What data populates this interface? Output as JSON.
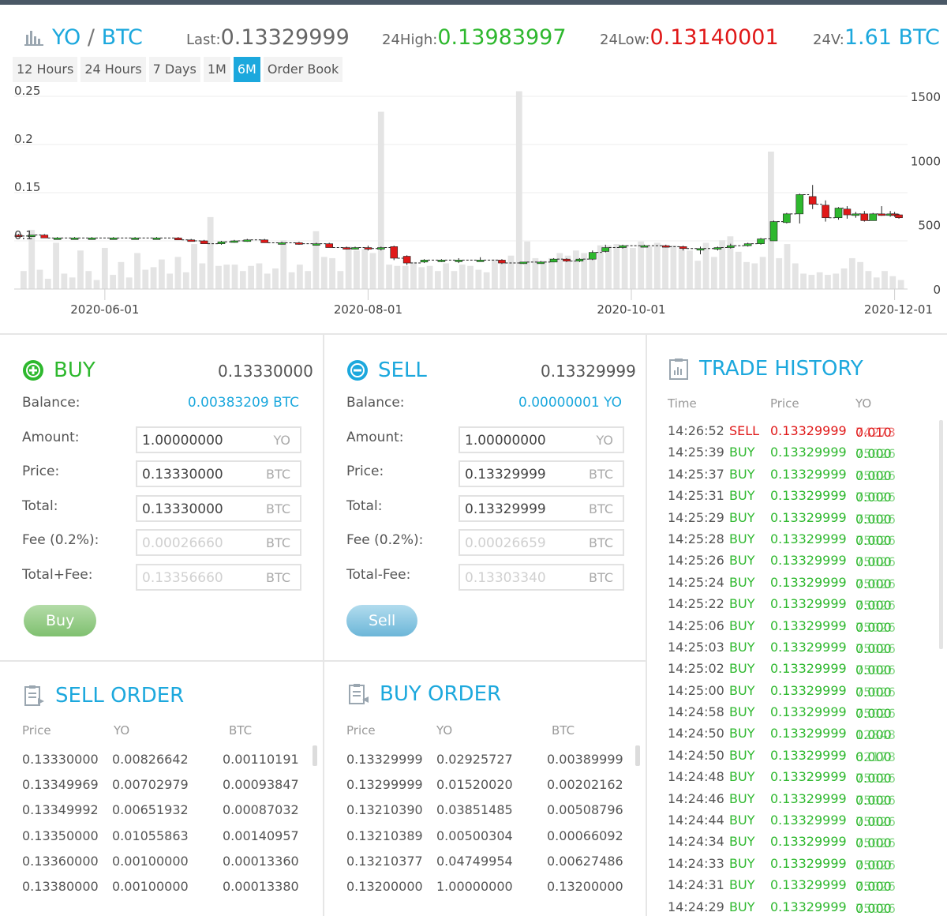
{
  "header": {
    "pair_base": "YO",
    "pair_sep": "/",
    "pair_quote": "BTC",
    "last_label": "Last:",
    "last_value": "0.13329999",
    "high_label": "24High:",
    "high_value": "0.13983997",
    "low_label": "24Low:",
    "low_value": "0.13140001",
    "vol_label": "24V:",
    "vol_value": "1.61 BTC"
  },
  "range_tabs": [
    {
      "label": "12 Hours",
      "active": false
    },
    {
      "label": "24 Hours",
      "active": false
    },
    {
      "label": "7 Days",
      "active": false
    },
    {
      "label": "1M",
      "active": false
    },
    {
      "label": "6M",
      "active": true
    },
    {
      "label": "Order Book",
      "active": false
    }
  ],
  "chart_data": {
    "type": "candlestick",
    "x_range": [
      "2020-05-11",
      "2020-12-04"
    ],
    "x_ticks": [
      "2020-06-01",
      "2020-08-01",
      "2020-10-01",
      "2020-12-01"
    ],
    "y_left": {
      "range": [
        0.05,
        0.25
      ],
      "ticks": [
        "0.25",
        "0.2",
        "0.15",
        "0.1"
      ]
    },
    "y_right": {
      "range": [
        0,
        1500
      ],
      "ticks": [
        "1500",
        "1000",
        "500",
        "0"
      ]
    },
    "grid": true,
    "colors": {
      "up": "#2eb82e",
      "down": "#e01818",
      "volume": "#e4e4e4"
    },
    "candles": [
      {
        "date": "2020-05-12",
        "open": 0.106,
        "high": 0.107,
        "low": 0.104,
        "close": 0.105
      },
      {
        "date": "2020-05-15",
        "open": 0.105,
        "high": 0.106,
        "low": 0.104,
        "close": 0.106
      },
      {
        "date": "2020-05-18",
        "open": 0.106,
        "high": 0.107,
        "low": 0.103,
        "close": 0.103
      },
      {
        "date": "2020-05-21",
        "open": 0.103,
        "high": 0.104,
        "low": 0.102,
        "close": 0.103
      },
      {
        "date": "2020-05-25",
        "open": 0.103,
        "high": 0.104,
        "low": 0.102,
        "close": 0.103
      },
      {
        "date": "2020-05-29",
        "open": 0.103,
        "high": 0.104,
        "low": 0.102,
        "close": 0.103
      },
      {
        "date": "2020-06-03",
        "open": 0.103,
        "high": 0.104,
        "low": 0.102,
        "close": 0.103
      },
      {
        "date": "2020-06-08",
        "open": 0.103,
        "high": 0.104,
        "low": 0.102,
        "close": 0.103
      },
      {
        "date": "2020-06-13",
        "open": 0.103,
        "high": 0.104,
        "low": 0.102,
        "close": 0.103
      },
      {
        "date": "2020-06-18",
        "open": 0.103,
        "high": 0.104,
        "low": 0.101,
        "close": 0.101
      },
      {
        "date": "2020-06-21",
        "open": 0.101,
        "high": 0.102,
        "low": 0.1,
        "close": 0.1
      },
      {
        "date": "2020-06-24",
        "open": 0.1,
        "high": 0.101,
        "low": 0.097,
        "close": 0.097
      },
      {
        "date": "2020-06-28",
        "open": 0.097,
        "high": 0.1,
        "low": 0.096,
        "close": 0.099
      },
      {
        "date": "2020-07-01",
        "open": 0.099,
        "high": 0.101,
        "low": 0.098,
        "close": 0.1
      },
      {
        "date": "2020-07-04",
        "open": 0.1,
        "high": 0.102,
        "low": 0.099,
        "close": 0.101
      },
      {
        "date": "2020-07-08",
        "open": 0.101,
        "high": 0.102,
        "low": 0.098,
        "close": 0.098
      },
      {
        "date": "2020-07-12",
        "open": 0.098,
        "high": 0.099,
        "low": 0.097,
        "close": 0.098
      },
      {
        "date": "2020-07-16",
        "open": 0.098,
        "high": 0.099,
        "low": 0.096,
        "close": 0.097
      },
      {
        "date": "2020-07-20",
        "open": 0.097,
        "high": 0.098,
        "low": 0.095,
        "close": 0.097
      },
      {
        "date": "2020-07-23",
        "open": 0.097,
        "high": 0.098,
        "low": 0.093,
        "close": 0.093
      },
      {
        "date": "2020-07-27",
        "open": 0.093,
        "high": 0.094,
        "low": 0.091,
        "close": 0.092
      },
      {
        "date": "2020-07-29",
        "open": 0.092,
        "high": 0.094,
        "low": 0.091,
        "close": 0.093
      },
      {
        "date": "2020-08-01",
        "open": 0.093,
        "high": 0.095,
        "low": 0.09,
        "close": 0.092
      },
      {
        "date": "2020-08-04",
        "open": 0.092,
        "high": 0.094,
        "low": 0.09,
        "close": 0.093
      },
      {
        "date": "2020-08-07",
        "open": 0.094,
        "high": 0.095,
        "low": 0.08,
        "close": 0.082
      },
      {
        "date": "2020-08-10",
        "open": 0.084,
        "high": 0.085,
        "low": 0.075,
        "close": 0.077
      },
      {
        "date": "2020-08-14",
        "open": 0.078,
        "high": 0.081,
        "low": 0.077,
        "close": 0.08
      },
      {
        "date": "2020-08-18",
        "open": 0.079,
        "high": 0.081,
        "low": 0.078,
        "close": 0.08
      },
      {
        "date": "2020-08-22",
        "open": 0.079,
        "high": 0.082,
        "low": 0.077,
        "close": 0.08
      },
      {
        "date": "2020-08-27",
        "open": 0.08,
        "high": 0.083,
        "low": 0.079,
        "close": 0.08
      },
      {
        "date": "2020-09-01",
        "open": 0.08,
        "high": 0.081,
        "low": 0.076,
        "close": 0.077
      },
      {
        "date": "2020-09-06",
        "open": 0.077,
        "high": 0.078,
        "low": 0.076,
        "close": 0.078
      },
      {
        "date": "2020-09-10",
        "open": 0.078,
        "high": 0.079,
        "low": 0.077,
        "close": 0.078
      },
      {
        "date": "2020-09-13",
        "open": 0.078,
        "high": 0.082,
        "low": 0.078,
        "close": 0.081
      },
      {
        "date": "2020-09-16",
        "open": 0.081,
        "high": 0.082,
        "low": 0.078,
        "close": 0.079
      },
      {
        "date": "2020-09-19",
        "open": 0.079,
        "high": 0.082,
        "low": 0.078,
        "close": 0.081
      },
      {
        "date": "2020-09-22",
        "open": 0.081,
        "high": 0.09,
        "low": 0.08,
        "close": 0.088
      },
      {
        "date": "2020-09-25",
        "open": 0.089,
        "high": 0.096,
        "low": 0.088,
        "close": 0.093
      },
      {
        "date": "2020-09-29",
        "open": 0.093,
        "high": 0.096,
        "low": 0.092,
        "close": 0.095
      },
      {
        "date": "2020-10-04",
        "open": 0.095,
        "high": 0.096,
        "low": 0.094,
        "close": 0.095
      },
      {
        "date": "2020-10-09",
        "open": 0.095,
        "high": 0.096,
        "low": 0.093,
        "close": 0.094
      },
      {
        "date": "2020-10-13",
        "open": 0.094,
        "high": 0.095,
        "low": 0.09,
        "close": 0.092
      },
      {
        "date": "2020-10-17",
        "open": 0.092,
        "high": 0.094,
        "low": 0.086,
        "close": 0.092
      },
      {
        "date": "2020-10-21",
        "open": 0.092,
        "high": 0.094,
        "low": 0.09,
        "close": 0.093
      },
      {
        "date": "2020-10-24",
        "open": 0.093,
        "high": 0.097,
        "low": 0.092,
        "close": 0.095
      },
      {
        "date": "2020-10-28",
        "open": 0.095,
        "high": 0.098,
        "low": 0.094,
        "close": 0.097
      },
      {
        "date": "2020-10-31",
        "open": 0.097,
        "high": 0.103,
        "low": 0.096,
        "close": 0.102
      },
      {
        "date": "2020-11-03",
        "open": 0.1,
        "high": 0.121,
        "low": 0.1,
        "close": 0.12
      },
      {
        "date": "2020-11-06",
        "open": 0.119,
        "high": 0.129,
        "low": 0.118,
        "close": 0.128
      },
      {
        "date": "2020-11-09",
        "open": 0.128,
        "high": 0.149,
        "low": 0.118,
        "close": 0.148
      },
      {
        "date": "2020-11-12",
        "open": 0.146,
        "high": 0.158,
        "low": 0.133,
        "close": 0.138
      },
      {
        "date": "2020-11-15",
        "open": 0.137,
        "high": 0.142,
        "low": 0.12,
        "close": 0.124
      },
      {
        "date": "2020-11-18",
        "open": 0.124,
        "high": 0.135,
        "low": 0.122,
        "close": 0.134
      },
      {
        "date": "2020-11-20",
        "open": 0.133,
        "high": 0.136,
        "low": 0.123,
        "close": 0.127
      },
      {
        "date": "2020-11-22",
        "open": 0.127,
        "high": 0.13,
        "low": 0.124,
        "close": 0.128
      },
      {
        "date": "2020-11-24",
        "open": 0.128,
        "high": 0.131,
        "low": 0.12,
        "close": 0.121
      },
      {
        "date": "2020-11-26",
        "open": 0.121,
        "high": 0.129,
        "low": 0.121,
        "close": 0.128
      },
      {
        "date": "2020-11-28",
        "open": 0.128,
        "high": 0.136,
        "low": 0.126,
        "close": 0.127
      },
      {
        "date": "2020-11-30",
        "open": 0.127,
        "high": 0.131,
        "low": 0.125,
        "close": 0.128
      },
      {
        "date": "2020-12-01",
        "open": 0.128,
        "high": 0.13,
        "low": 0.125,
        "close": 0.127
      },
      {
        "date": "2020-12-02",
        "open": 0.127,
        "high": 0.128,
        "low": 0.123,
        "close": 0.124
      }
    ],
    "volume": [
      140,
      460,
      150,
      80,
      360,
      120,
      90,
      300,
      140,
      70,
      320,
      110,
      210,
      90,
      280,
      150,
      170,
      230,
      120,
      250,
      130,
      350,
      200,
      560,
      180,
      190,
      190,
      140,
      180,
      200,
      120,
      160,
      380,
      130,
      190,
      140,
      450,
      250,
      240,
      140,
      330,
      300,
      310,
      280,
      1380,
      190,
      180,
      180,
      210,
      170,
      180,
      140,
      200,
      140,
      190,
      180,
      150,
      130,
      230,
      200,
      260,
      1540,
      370,
      240,
      220,
      240,
      280,
      260,
      300,
      280,
      250,
      340,
      340,
      350,
      330,
      320,
      370,
      330,
      360,
      330,
      340,
      310,
      300,
      220,
      360,
      250,
      380,
      410,
      290,
      210,
      200,
      250,
      1070,
      240,
      350,
      200,
      120,
      110,
      130,
      110,
      120,
      160,
      240,
      210,
      140,
      90,
      140,
      100,
      70
    ]
  },
  "buy": {
    "title": "BUY",
    "price": "0.13330000",
    "balance_label": "Balance:",
    "balance_value": "0.00383209 BTC",
    "amount_label": "Amount:",
    "amount_value": "1.00000000",
    "amount_unit": "YO",
    "price_label": "Price:",
    "price_value": "0.13330000",
    "price_unit": "BTC",
    "total_label": "Total:",
    "total_value": "0.13330000",
    "total_unit": "BTC",
    "fee_label": "Fee (0.2%):",
    "fee_value": "0.00026660",
    "fee_unit": "BTC",
    "grand_label": "Total+Fee:",
    "grand_value": "0.13356660",
    "grand_unit": "BTC",
    "button": "Buy"
  },
  "sell": {
    "title": "SELL",
    "price": "0.13329999",
    "balance_label": "Balance:",
    "balance_value": "0.00000001 YO",
    "amount_label": "Amount:",
    "amount_value": "1.00000000",
    "amount_unit": "YO",
    "price_label": "Price:",
    "price_value": "0.13329999",
    "price_unit": "BTC",
    "total_label": "Total:",
    "total_value": "0.13329999",
    "total_unit": "BTC",
    "fee_label": "Fee (0.2%):",
    "fee_value": "0.00026659",
    "fee_unit": "BTC",
    "grand_label": "Total-Fee:",
    "grand_value": "0.13303340",
    "grand_unit": "BTC",
    "button": "Sell"
  },
  "sell_order": {
    "title": "SELL ORDER",
    "columns": [
      "Price",
      "YO",
      "BTC"
    ],
    "rows": [
      [
        "0.13330000",
        "0.00826642",
        "0.00110191"
      ],
      [
        "0.13349969",
        "0.00702979",
        "0.00093847"
      ],
      [
        "0.13349992",
        "0.00651932",
        "0.00087032"
      ],
      [
        "0.13350000",
        "0.01055863",
        "0.00140957"
      ],
      [
        "0.13360000",
        "0.00100000",
        "0.00013360"
      ],
      [
        "0.13380000",
        "0.00100000",
        "0.00013380"
      ]
    ]
  },
  "buy_order": {
    "title": "BUY ORDER",
    "columns": [
      "Price",
      "YO",
      "BTC"
    ],
    "rows": [
      [
        "0.13329999",
        "0.02925727",
        "0.00389999"
      ],
      [
        "0.13299999",
        "0.01520020",
        "0.00202162"
      ],
      [
        "0.13210390",
        "0.03851485",
        "0.00508796"
      ],
      [
        "0.13210389",
        "0.00500304",
        "0.00066092"
      ],
      [
        "0.13210377",
        "0.04749954",
        "0.00627486"
      ],
      [
        "0.13200000",
        "1.00000000",
        "0.13200000"
      ]
    ]
  },
  "trade_history": {
    "title": "TRADE HISTORY",
    "columns": [
      "Time",
      "Price",
      "YO"
    ],
    "rows": [
      {
        "time": "14:26:52",
        "type": "SELL",
        "price": "0.13329999",
        "amt_a": "0.010",
        "amt_b": "74273"
      },
      {
        "time": "14:25:39",
        "type": "BUY",
        "price": "0.13329999",
        "amt_a": "0.000",
        "amt_b": "75026"
      },
      {
        "time": "14:25:37",
        "type": "BUY",
        "price": "0.13329999",
        "amt_a": "0.000",
        "amt_b": "75026"
      },
      {
        "time": "14:25:31",
        "type": "BUY",
        "price": "0.13329999",
        "amt_a": "0.000",
        "amt_b": "75026"
      },
      {
        "time": "14:25:29",
        "type": "BUY",
        "price": "0.13329999",
        "amt_a": "0.000",
        "amt_b": "75026"
      },
      {
        "time": "14:25:28",
        "type": "BUY",
        "price": "0.13329999",
        "amt_a": "0.000",
        "amt_b": "75026"
      },
      {
        "time": "14:25:26",
        "type": "BUY",
        "price": "0.13329999",
        "amt_a": "0.000",
        "amt_b": "75026"
      },
      {
        "time": "14:25:24",
        "type": "BUY",
        "price": "0.13329999",
        "amt_a": "0.000",
        "amt_b": "75026"
      },
      {
        "time": "14:25:22",
        "type": "BUY",
        "price": "0.13329999",
        "amt_a": "0.000",
        "amt_b": "75026"
      },
      {
        "time": "14:25:06",
        "type": "BUY",
        "price": "0.13329999",
        "amt_a": "0.000",
        "amt_b": "75026"
      },
      {
        "time": "14:25:03",
        "type": "BUY",
        "price": "0.13329999",
        "amt_a": "0.000",
        "amt_b": "75026"
      },
      {
        "time": "14:25:02",
        "type": "BUY",
        "price": "0.13329999",
        "amt_a": "0.000",
        "amt_b": "75026"
      },
      {
        "time": "14:25:00",
        "type": "BUY",
        "price": "0.13329999",
        "amt_a": "0.000",
        "amt_b": "75026"
      },
      {
        "time": "14:24:58",
        "type": "BUY",
        "price": "0.13329999",
        "amt_a": "0.000",
        "amt_b": "75026"
      },
      {
        "time": "14:24:50",
        "type": "BUY",
        "price": "0.13329999",
        "amt_a": "0.000",
        "amt_b": "12848"
      },
      {
        "time": "14:24:50",
        "type": "BUY",
        "price": "0.13329999",
        "amt_a": "0.000",
        "amt_b": "62178"
      },
      {
        "time": "14:24:48",
        "type": "BUY",
        "price": "0.13329999",
        "amt_a": "0.000",
        "amt_b": "75026"
      },
      {
        "time": "14:24:46",
        "type": "BUY",
        "price": "0.13329999",
        "amt_a": "0.000",
        "amt_b": "75026"
      },
      {
        "time": "14:24:44",
        "type": "BUY",
        "price": "0.13329999",
        "amt_a": "0.000",
        "amt_b": "75026"
      },
      {
        "time": "14:24:34",
        "type": "BUY",
        "price": "0.13329999",
        "amt_a": "0.000",
        "amt_b": "75026"
      },
      {
        "time": "14:24:33",
        "type": "BUY",
        "price": "0.13329999",
        "amt_a": "0.000",
        "amt_b": "75026"
      },
      {
        "time": "14:24:31",
        "type": "BUY",
        "price": "0.13329999",
        "amt_a": "0.000",
        "amt_b": "75026"
      },
      {
        "time": "14:24:29",
        "type": "BUY",
        "price": "0.13329999",
        "amt_a": "0.000",
        "amt_b": "75026"
      }
    ]
  },
  "icons": {
    "pair": "bar-chart-icon",
    "buy": "plus-circle-icon",
    "sell": "minus-circle-icon",
    "orders": "clipboard-icon",
    "history": "document-chart-icon"
  }
}
